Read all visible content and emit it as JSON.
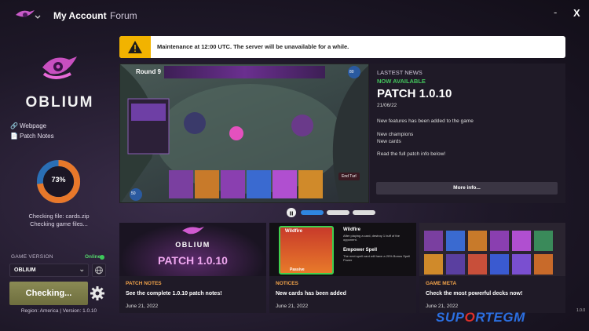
{
  "nav": {
    "account": "My Account",
    "forum": "Forum",
    "minimize": "-",
    "close": "X"
  },
  "sidebar": {
    "brand": "OBLIUM",
    "links": [
      {
        "label": "Webpage",
        "icon": "link-icon"
      },
      {
        "label": "Patch Notes",
        "icon": "notes-icon"
      }
    ],
    "progress": {
      "percent": 73,
      "label": "73%"
    },
    "status_lines": [
      "Checking file: cards.zip",
      "Checking game files..."
    ],
    "game_version_label": "GAME VERSION",
    "online_label": "Online",
    "selected_version": "OBLIUM",
    "check_button": "Checking...",
    "region_line": "Region: America | Version: 1.0.10"
  },
  "maintenance": {
    "text": "Maintenance at 12:00 UTC. The server will be unavailable for a while."
  },
  "hero": {
    "round": "Round 9",
    "end_turn": "End Turl",
    "score_left": "50",
    "score_right": "80"
  },
  "news": {
    "header": "LASTEST NEWS",
    "status": "NOW AVAILABLE",
    "title": "PATCH 1.0.10",
    "date": "21/06/22",
    "paragraphs": [
      "New features has been added to the game",
      "New champions",
      "New cards",
      "Read the full patch info below!"
    ],
    "button": "More info..."
  },
  "cards": [
    {
      "tag": "PATCH NOTES",
      "title": "See the complete 1.0.10 patch notes!",
      "date": "June 21, 2022",
      "img_brand": "OBLIUM",
      "img_title": "PATCH 1.0.10"
    },
    {
      "tag": "NOTICES",
      "title": "New cards has been added",
      "date": "June 21, 2022",
      "img_card": "Wildfire",
      "img_passive": "Passive",
      "img_ability1": "Wildfire",
      "img_ability2": "Empower Spell",
      "img_desc1": "After playing a card, destroy 1 buff of the opponent.",
      "img_desc2": "The next spell card will have a 20% Bonus Spell Power"
    },
    {
      "tag": "GAME META",
      "title": "Check the most powerful decks now!",
      "date": "June 21, 2022"
    }
  ],
  "watermark": {
    "text1": "SUP",
    "text2": "O",
    "text3": "RTEGM"
  },
  "version_badge": "1.0.0"
}
